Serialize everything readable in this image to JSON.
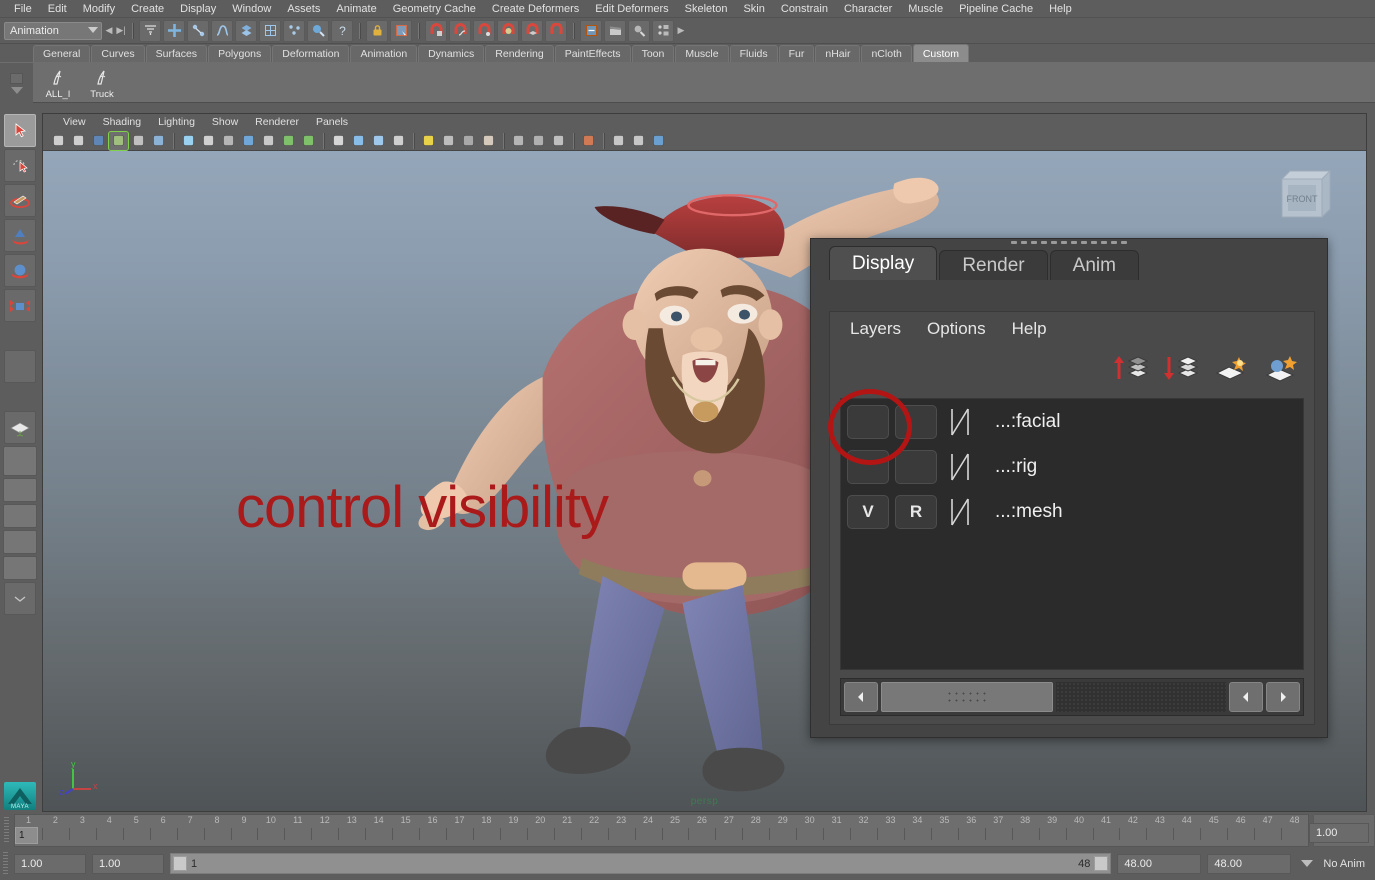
{
  "menubar": {
    "items": [
      "File",
      "Edit",
      "Modify",
      "Create",
      "Display",
      "Window",
      "Assets",
      "Animate",
      "Geometry Cache",
      "Create Deformers",
      "Edit Deformers",
      "Skeleton",
      "Skin",
      "Constrain",
      "Character",
      "Muscle",
      "Pipeline Cache",
      "Help"
    ]
  },
  "statusline": {
    "mode": "Animation",
    "icons": [
      "snap-grid-icon",
      "move-icon",
      "rotate-icon",
      "curve-icon",
      "surface-icon",
      "lattice-icon",
      "particles-icon",
      "paint-icon",
      "help-icon",
      "lock-icon",
      "render-select-icon",
      "magnet-grid-icon",
      "magnet-curve-icon",
      "magnet-point-icon",
      "magnet-view-icon",
      "magnet-surface-icon",
      "magnet-snap-icon",
      "history-icon",
      "clapboard-icon",
      "render-icon",
      "render-seq-icon"
    ]
  },
  "shelf": {
    "tabs": [
      "General",
      "Curves",
      "Surfaces",
      "Polygons",
      "Deformation",
      "Animation",
      "Dynamics",
      "Rendering",
      "PaintEffects",
      "Toon",
      "Muscle",
      "Fluids",
      "Fur",
      "nHair",
      "nCloth",
      "Custom"
    ],
    "active_tab": "Custom",
    "buttons": [
      {
        "label": "ALL_I",
        "icon": "character-icon"
      },
      {
        "label": "Truck",
        "icon": "character-icon"
      }
    ]
  },
  "toolbox": {
    "items": [
      "select-tool",
      "lasso-select-tool",
      "paint-select-tool",
      "move-tool",
      "rotate-tool",
      "scale-tool",
      "blank-tool",
      "last-tool",
      "single-view-layout",
      "four-view-layout",
      "outliner-persp-layout",
      "persp-graph-layout",
      "hypershade-persp-layout",
      "persp-outliner-graph-layout",
      "more-layouts"
    ],
    "logo": "MAYA"
  },
  "viewport": {
    "menus": [
      "View",
      "Shading",
      "Lighting",
      "Show",
      "Renderer",
      "Panels"
    ],
    "toolbar_icons": [
      "select-camera-icon",
      "bookmark-icon",
      "image-plane-icon",
      "paint-icon",
      "grid-icon",
      "resolution-gate-icon",
      "exposure-icon",
      "film-gate-icon",
      "light-globe-icon",
      "sphere-shade-icon",
      "xray-icon",
      "texture-icon",
      "text-icon",
      "wireframe-icon",
      "smooth-shade-icon",
      "shaded-wire-icon",
      "checker-icon",
      "light-bulb-icon",
      "default-light-icon",
      "all-lights-icon",
      "shadow-icon",
      "ao-icon",
      "motion-blur-icon",
      "msaa-icon",
      "isolate-select-icon",
      "xray-joints-icon",
      "xray-active-icon",
      "exposure-share-icon"
    ],
    "camera_label": "persp",
    "viewcube_label": "FRONT",
    "axis": {
      "x": "x",
      "y": "y",
      "z": "z"
    },
    "bg_top_color": "#94a6b9",
    "bg_bottom_color": "#4f5457"
  },
  "annotation": {
    "text": "control visibility",
    "color": "#ab1a1a",
    "highlight_shape": "red-circle"
  },
  "layer_panel": {
    "tabs": [
      {
        "label": "Display",
        "active": true
      },
      {
        "label": "Render",
        "active": false
      },
      {
        "label": "Anim",
        "active": false
      }
    ],
    "menus": [
      "Layers",
      "Options",
      "Help"
    ],
    "toolbar_icons": [
      "move-layer-up-icon",
      "move-layer-down-icon",
      "new-layer-icon",
      "new-layer-from-selected-icon"
    ],
    "layers": [
      {
        "visibility": "",
        "playback": "",
        "curve": "ramp-icon",
        "name": "...:facial"
      },
      {
        "visibility": "",
        "playback": "",
        "curve": "ramp-icon",
        "name": "...:rig"
      },
      {
        "visibility": "V",
        "playback": "R",
        "curve": "ramp-icon",
        "name": "...:mesh"
      }
    ],
    "scroll": {
      "left_arrow": "◀",
      "right_arrow_1": "◀",
      "right_arrow_2": "▶"
    }
  },
  "timeline": {
    "start": 1,
    "end": 48,
    "current_frame": "1",
    "tick_labels": [
      "1",
      "2",
      "3",
      "4",
      "5",
      "6",
      "7",
      "8",
      "9",
      "10",
      "11",
      "12",
      "13",
      "14",
      "15",
      "16",
      "17",
      "18",
      "19",
      "20",
      "21",
      "22",
      "23",
      "24",
      "25",
      "26",
      "27",
      "28",
      "29",
      "30",
      "31",
      "32",
      "33",
      "34",
      "35",
      "36",
      "37",
      "38",
      "39",
      "40",
      "41",
      "42",
      "43",
      "44",
      "45",
      "46",
      "47",
      "48"
    ],
    "playback_speed_field": "1.00"
  },
  "rangebar": {
    "range_start": "1.00",
    "range_start_2": "1.00",
    "slider_min_label": "1",
    "slider_max_label": "48",
    "range_end": "48.00",
    "anim_end": "48.00",
    "anim_layer": "No Anim"
  }
}
